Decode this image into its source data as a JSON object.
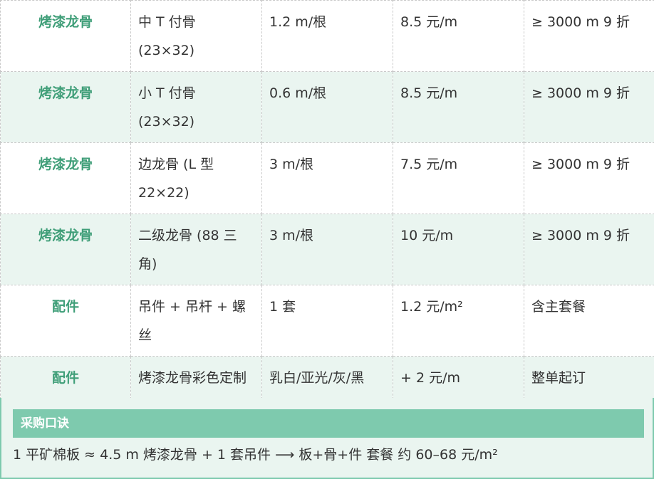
{
  "colors": {
    "category": "#3f9e78",
    "row_alt_bg": "#eaf5f0",
    "tip_header_bg": "#7ecaae"
  },
  "rows": [
    {
      "category": "烤漆龙骨",
      "name_line1": "中 T 付骨",
      "name_line2": "(23×32)",
      "length": "1.2 m/根",
      "price": "8.5 元/m",
      "discount": "≥ 3000 m  9 折"
    },
    {
      "category": "烤漆龙骨",
      "name_line1": "小 T 付骨",
      "name_line2": "(23×32)",
      "length": "0.6 m/根",
      "price": "8.5 元/m",
      "discount": "≥ 3000 m  9 折"
    },
    {
      "category": "烤漆龙骨",
      "name_line1": "边龙骨 (L 型",
      "name_line2": "22×22)",
      "length": "3 m/根",
      "price": "7.5 元/m",
      "discount": "≥ 3000 m  9 折"
    },
    {
      "category": "烤漆龙骨",
      "name_line1": "二级龙骨 (88 三",
      "name_line2": "角)",
      "length": "3 m/根",
      "price": "10 元/m",
      "discount": "≥ 3000 m  9 折"
    },
    {
      "category": "配件",
      "name_line1": "吊件 + 吊杆 + 螺",
      "name_line2": "丝",
      "length": "1 套",
      "price": "1.2 元/m²",
      "discount": "含主套餐"
    },
    {
      "category": "配件",
      "name_line1": "烤漆龙骨彩色定制",
      "name_line2": "",
      "length": "乳白/亚光/灰/黑",
      "price": "+ 2 元/m",
      "discount": "整单起订"
    }
  ],
  "tip": {
    "title": "采购口诀",
    "text": "1 平矿棉板 ≈ 4.5 m 烤漆龙骨 + 1 套吊件 ⟶ 板+骨+件 套餐 约 60–68 元/m²"
  }
}
